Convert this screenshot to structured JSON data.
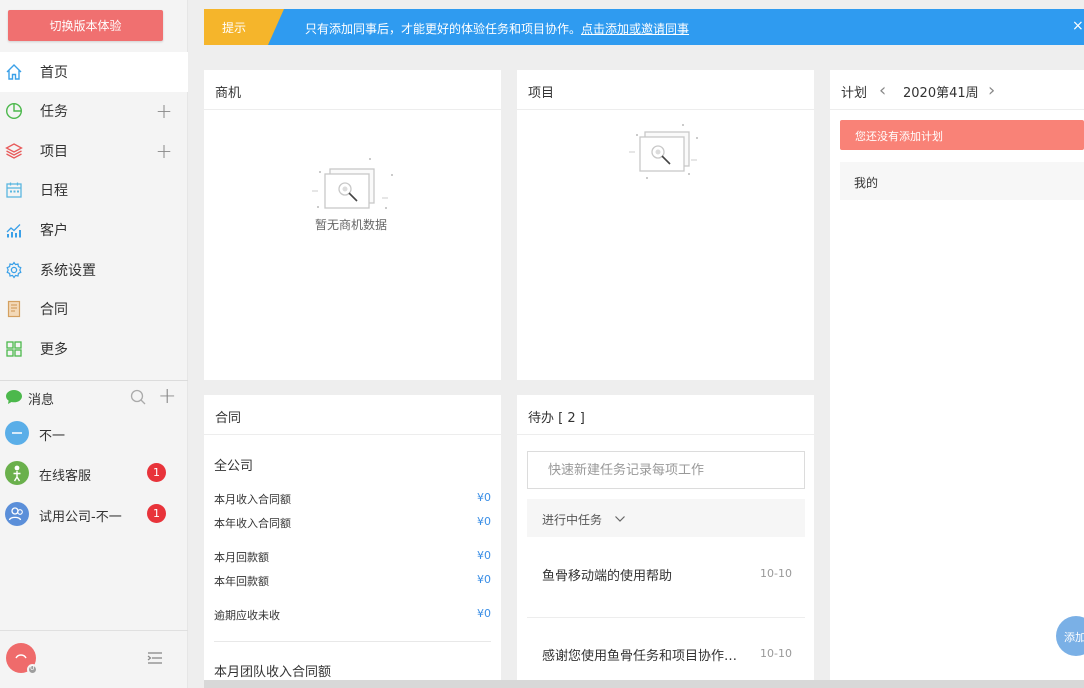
{
  "sidebar": {
    "switch_label": "切换版本体验",
    "nav": [
      {
        "label": "首页",
        "icon": "home-icon",
        "color": "#3aa0e8"
      },
      {
        "label": "任务",
        "icon": "task-pie-icon",
        "color": "#4cb84c"
      },
      {
        "label": "项目",
        "icon": "project-layers-icon",
        "color": "#e85a5a"
      },
      {
        "label": "日程",
        "icon": "calendar-icon",
        "color": "#5bb7e0"
      },
      {
        "label": "客户",
        "icon": "customer-chart-icon",
        "color": "#3aa0e8"
      },
      {
        "label": "系统设置",
        "icon": "settings-gear-icon",
        "color": "#3aa0e8"
      },
      {
        "label": "合同",
        "icon": "contract-icon",
        "color": "#d4a060"
      },
      {
        "label": "更多",
        "icon": "more-grid-icon",
        "color": "#4cb84c"
      }
    ],
    "messages": {
      "title": "消息",
      "contacts": [
        {
          "name": "不一",
          "badge": ""
        },
        {
          "name": "在线客服",
          "badge": "1"
        },
        {
          "name": "试用公司-不一",
          "badge": "1"
        }
      ]
    },
    "user_status_badge": "0"
  },
  "banner": {
    "tag": "提示",
    "text": "只有添加同事后，才能更好的体验任务和项目协作。",
    "link": "点击添加或邀请同事",
    "close": "×"
  },
  "deals": {
    "title": "商机",
    "empty_text": "暂无商机数据"
  },
  "projects": {
    "title": "项目"
  },
  "plan": {
    "title": "计划",
    "week": "2020第41周",
    "alert": "您还没有添加计划",
    "mine": "我的"
  },
  "contracts": {
    "title": "合同",
    "scope": "全公司",
    "rows": [
      {
        "label": "本月收入合同额",
        "value": "¥0"
      },
      {
        "label": "本年收入合同额",
        "value": "¥0"
      },
      {
        "label": "本月回款额",
        "value": "¥0"
      },
      {
        "label": "本年回款额",
        "value": "¥0"
      },
      {
        "label": "逾期应收未收",
        "value": "¥0"
      }
    ],
    "team_title": "本月团队收入合同额"
  },
  "todo": {
    "title": "待办 [ 2 ]",
    "input_placeholder": "快速新建任务记录每项工作",
    "filter": "进行中任务",
    "items": [
      {
        "title": "鱼骨移动端的使用帮助",
        "date": "10-10"
      },
      {
        "title": "感谢您使用鱼骨任务和项目协作…",
        "date": "10-10"
      }
    ]
  },
  "fab_label": "添加"
}
